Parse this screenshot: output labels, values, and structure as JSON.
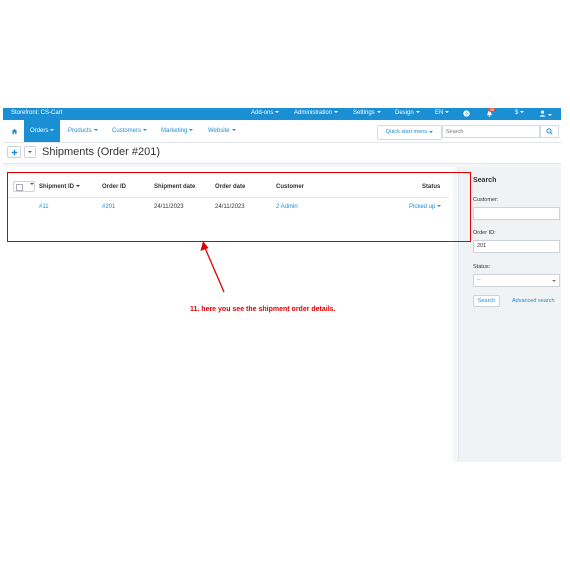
{
  "topbar": {
    "storefront": "Storefront: CS-Cart",
    "menus": [
      "Add-ons",
      "Administration",
      "Settings",
      "Design",
      "EN",
      "$"
    ],
    "notification_count": "35"
  },
  "navbar": {
    "items": [
      "Orders",
      "Products",
      "Customers",
      "Marketing",
      "Website"
    ],
    "quick_start": "Quick start menu",
    "search_placeholder": "Search"
  },
  "page": {
    "title": "Shipments (Order #201)"
  },
  "table": {
    "columns": [
      "Shipment ID",
      "Order ID",
      "Shipment date",
      "Order date",
      "Customer",
      "Status"
    ],
    "rows": [
      {
        "shipment_id": "#11",
        "order_id": "#201",
        "shipment_date": "24/11/2023",
        "order_date": "24/11/2023",
        "customer": "2 Admin",
        "status": "Picked up"
      }
    ]
  },
  "sidebar": {
    "title": "Search",
    "customer_label": "Customer:",
    "customer_value": "",
    "order_id_label": "Order ID:",
    "order_id_value": "201",
    "status_label": "Status:",
    "status_value": "--",
    "search_button": "Search",
    "advanced_search": "Advanced search"
  },
  "annotation": {
    "text": "11. here you see the shipment order details."
  },
  "colors": {
    "accent": "#1a8fd3",
    "annotation": "#e00000",
    "badge": "#e74c3c"
  }
}
